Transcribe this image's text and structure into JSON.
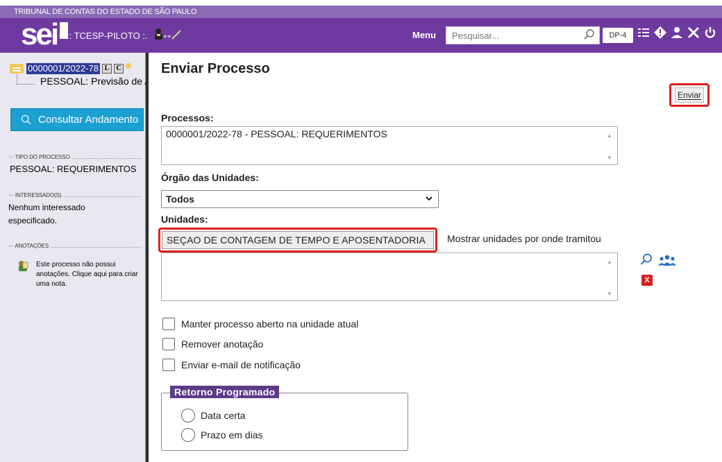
{
  "org_bar": {
    "title": "TRIBUNAL DE CONTAS DO ESTADO DE SÃO PAULO"
  },
  "header": {
    "logo": "sei",
    "system_name": ".: TCESP-PILOTO :.",
    "user_tag": "++",
    "menu_label": "Menu",
    "search_placeholder": "Pesquisar...",
    "unit_badge": "DP-4",
    "icons": [
      "list-icon",
      "alert-icon",
      "user-icon",
      "tools-icon",
      "power-icon"
    ]
  },
  "sidebar": {
    "process_number": "0000001/2022-78",
    "badge_l": "L",
    "badge_c": "C",
    "document": "PESSOAL: Previsão de Aposentadoria",
    "consult_button": "Consultar Andamento",
    "section_tipo": "TIPO DO PROCESSO",
    "tipo_value": "PESSOAL: REQUERIMENTOS",
    "section_interessados": "INTERESSADO(S)",
    "interessados_value_1": "Nenhum interessado",
    "interessados_value_2": "especificado.",
    "section_anotacoes": "ANOTAÇÕES",
    "anotacoes_value": "Este processo não possui anotações. Clique aqui para criar uma nota."
  },
  "main": {
    "title": "Enviar Processo",
    "send_button": "Enviar",
    "processos_label": "Processos:",
    "processos_value": "0000001/2022-78 - PESSOAL: REQUERIMENTOS",
    "orgao_label": "Órgão das Unidades:",
    "orgao_selected": "Todos",
    "unidades_label": "Unidades:",
    "unidade_input": "SEÇAO DE CONTAGEM DE TEMPO E APOSENTADORIA",
    "show_units_link": "Mostrar unidades por onde tramitou",
    "remove_icon_text": "X",
    "checkboxes": [
      "Manter processo aberto na unidade atual",
      "Remover anotação",
      "Enviar e-mail de notificação"
    ],
    "retorno_legend": "Retorno Programado",
    "radios": [
      "Data certa",
      "Prazo em dias"
    ]
  },
  "colors": {
    "header": "#6f3aa0",
    "org_bar": "#8b6cb4",
    "consult_button": "#1c9fd1",
    "highlight": "#e02020",
    "legend": "#5e3a87"
  }
}
